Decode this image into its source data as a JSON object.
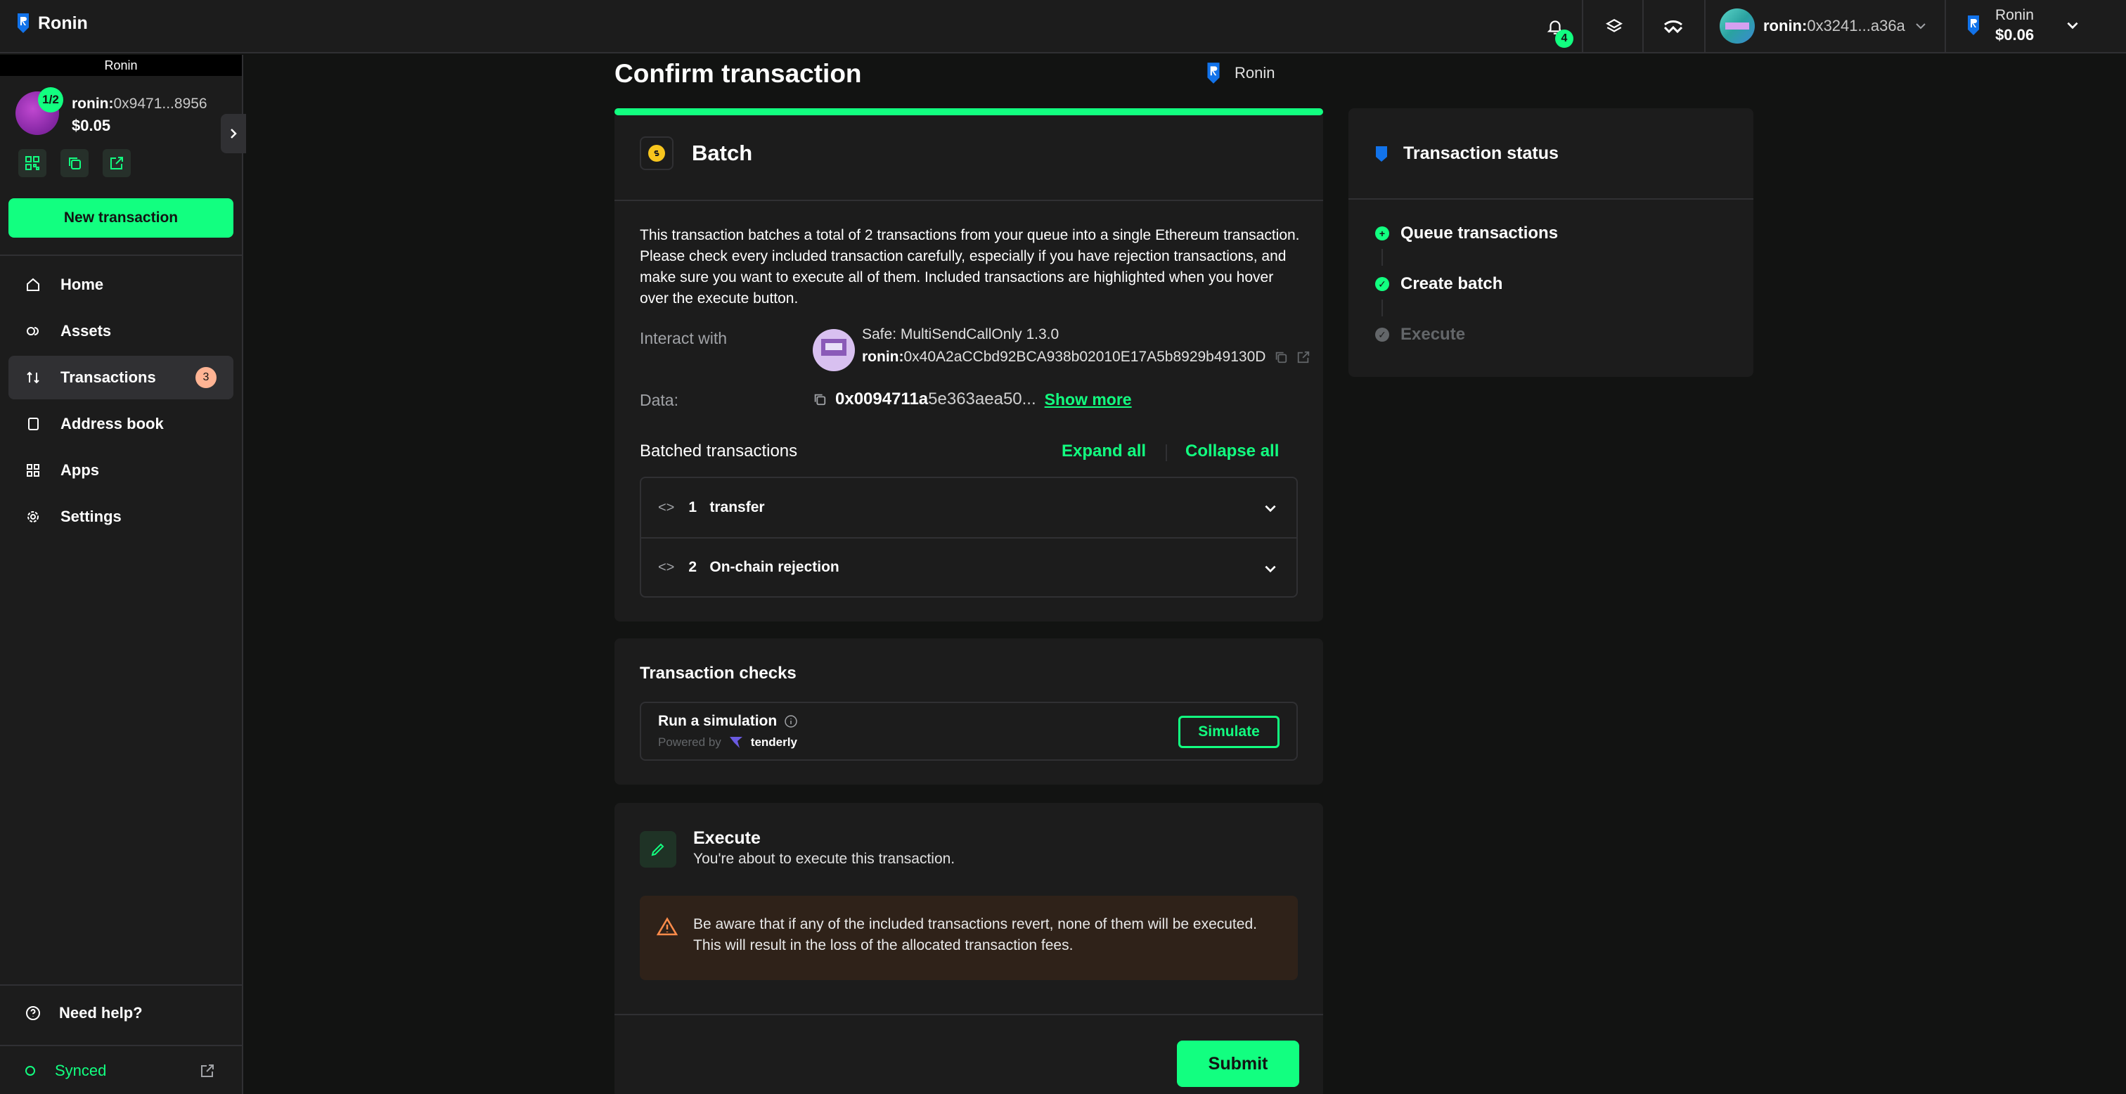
{
  "app": {
    "name": "Ronin"
  },
  "topbar": {
    "notifications_count": "4",
    "account_prefix": "ronin:",
    "account_address": "0x3241...a36a",
    "network_name": "Ronin",
    "network_balance": "$0.06"
  },
  "sidebar": {
    "chain_label": "Ronin",
    "threshold": "1/2",
    "safe_prefix": "ronin:",
    "safe_address": "0x9471...8956",
    "safe_balance": "$0.05",
    "new_tx_label": "New transaction",
    "nav": [
      {
        "label": "Home",
        "icon": "home-icon"
      },
      {
        "label": "Assets",
        "icon": "assets-icon"
      },
      {
        "label": "Transactions",
        "icon": "transactions-icon",
        "badge": "3"
      },
      {
        "label": "Address book",
        "icon": "address-book-icon"
      },
      {
        "label": "Apps",
        "icon": "apps-icon"
      },
      {
        "label": "Settings",
        "icon": "settings-icon"
      }
    ],
    "help_label": "Need help?",
    "synced_label": "Synced"
  },
  "main": {
    "title": "Confirm transaction",
    "chain": "Ronin",
    "batch": {
      "title": "Batch",
      "description": "This transaction batches a total of 2 transactions from your queue into a single Ethereum transaction. Please check every included transaction carefully, especially if you have rejection transactions, and make sure you want to execute all of them. Included transactions are highlighted when you hover over the execute button.",
      "interact_label": "Interact with",
      "contract_name": "Safe: MultiSendCallOnly 1.3.0",
      "contract_prefix": "ronin:",
      "contract_address": "0x40A2aCCbd92BCA938b02010E17A5b8929b49130D",
      "data_label": "Data:",
      "data_bold": "0x0094711a",
      "data_rest": "5e363aea50...",
      "show_more": "Show more",
      "batched_label": "Batched transactions",
      "expand_all": "Expand all",
      "collapse_all": "Collapse all",
      "transactions": [
        {
          "index": "1",
          "name": "transfer"
        },
        {
          "index": "2",
          "name": "On-chain rejection"
        }
      ]
    },
    "checks": {
      "title": "Transaction checks",
      "simulation_title": "Run a simulation",
      "powered_by": "Powered by",
      "provider": "tenderly",
      "simulate_label": "Simulate"
    },
    "execute": {
      "title": "Execute",
      "subtitle": "You're about to execute this transaction.",
      "warning": "Be aware that if any of the included transactions revert, none of them will be executed. This will result in the loss of the allocated transaction fees.",
      "submit_label": "Submit"
    }
  },
  "status": {
    "title": "Transaction status",
    "steps": [
      {
        "label": "Queue transactions",
        "state": "done"
      },
      {
        "label": "Create batch",
        "state": "done"
      },
      {
        "label": "Execute",
        "state": "pending"
      }
    ]
  },
  "colors": {
    "accent": "#12ff80",
    "background": "#121312",
    "surface": "#1c1c1c",
    "warning_bg": "#2f2219",
    "badge": "#ffb494"
  }
}
